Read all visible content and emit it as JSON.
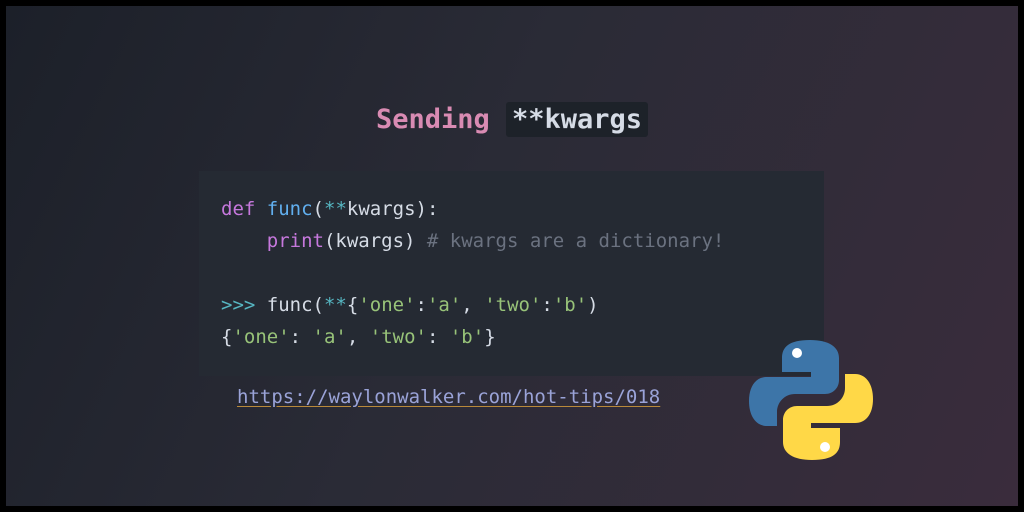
{
  "title": {
    "prefix": "Sending",
    "code": "**kwargs"
  },
  "code": {
    "line1": {
      "kw": "def",
      "fn": "func",
      "paren_open": "(",
      "op": "**",
      "arg": "kwargs",
      "rest": "):"
    },
    "line2": {
      "indent": "    ",
      "fn": "print",
      "rest": "(kwargs) ",
      "comment": "# kwargs are a dictionary!"
    },
    "line4": {
      "prompt": ">>>",
      "call": " func(",
      "op": "**",
      "brace": "{",
      "s1": "'one'",
      "c1": ":",
      "s2": "'a'",
      "sep": ", ",
      "s3": "'two'",
      "c2": ":",
      "s4": "'b'",
      "close": ")"
    },
    "line5": {
      "brace_open": "{",
      "s1": "'one'",
      "c1": ": ",
      "s2": "'a'",
      "sep": ", ",
      "s3": "'two'",
      "c2": ": ",
      "s4": "'b'",
      "brace_close": "}"
    }
  },
  "link": {
    "text": "https://waylonwalker.com/hot-tips/018"
  },
  "icons": {
    "logo": "python-logo-icon"
  },
  "colors": {
    "blue": "#3d75a8",
    "yellow": "#ffd847",
    "accent": "#d98bb3"
  }
}
